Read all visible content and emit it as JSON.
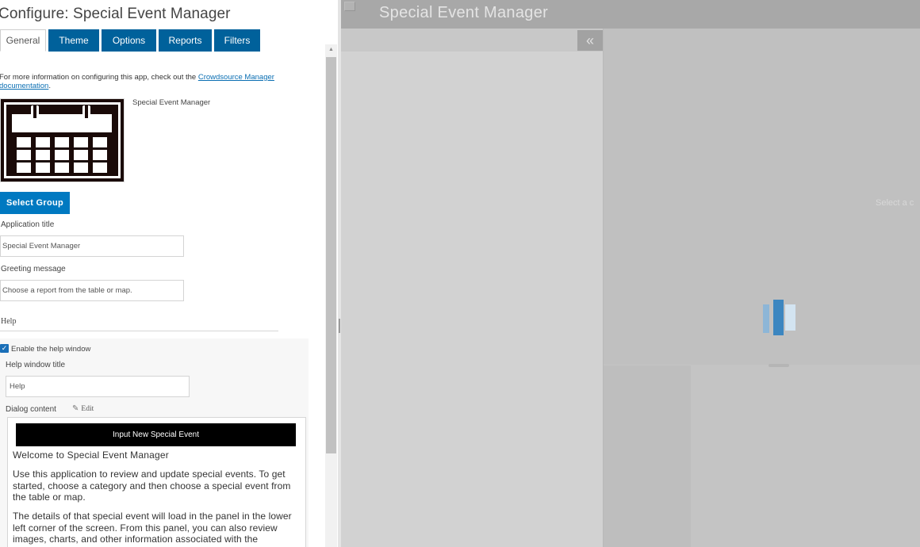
{
  "config": {
    "title": "Configure: Special Event Manager",
    "tabs": [
      {
        "label": "General",
        "active": true
      },
      {
        "label": "Theme",
        "active": false
      },
      {
        "label": "Options",
        "active": false
      },
      {
        "label": "Reports",
        "active": false
      },
      {
        "label": "Filters",
        "active": false
      }
    ],
    "info": {
      "prefix": "For more information on configuring this app, check out the ",
      "link_line1": "Crowdsource Manager",
      "link_line2": "documentation",
      "suffix": "."
    },
    "app_icon": {
      "icon": "calendar-icon",
      "caption": "Special Event Manager"
    },
    "select_group_label": "Select Group",
    "application_title": {
      "label": "Application title",
      "value": "Special Event Manager"
    },
    "greeting_message": {
      "label": "Greeting message",
      "value": "Choose a report from the table or map."
    },
    "help": {
      "heading": "Help",
      "enable_label": "Enable the help window",
      "enabled": true,
      "window_title": {
        "label": "Help window title",
        "value": "Help"
      },
      "dialog_content_label": "Dialog content",
      "edit_label": "Edit",
      "dialog": {
        "button_label": "Input New Special Event",
        "heading": "Welcome to Special Event Manager",
        "paragraphs": [
          "Use this application to review and update special events. To get started, choose a category and then choose a special event from the table or map.",
          "The details of that special event will load in the panel in the lower left corner of the screen. From this panel, you can also review images, charts, and other information associated with the selected"
        ]
      }
    }
  },
  "preview": {
    "title": "Special Event Manager",
    "collapse_icon": "double-chevron-left-icon",
    "hint_text": "Select a c",
    "colors": {
      "header": "#a8a8a8",
      "loader": "#3c86c0"
    }
  },
  "colors": {
    "tab": "#00619b",
    "primary_button": "#0079c1",
    "link": "#0b6fb3"
  }
}
